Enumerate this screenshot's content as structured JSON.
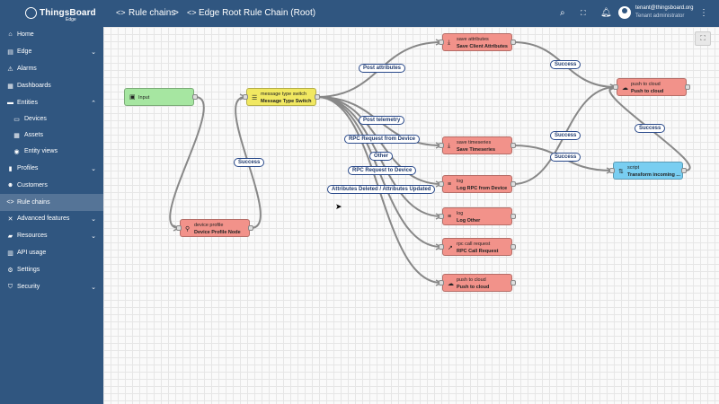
{
  "app": {
    "logo_text": "ThingsBoard",
    "logo_sub": "Edge"
  },
  "sidebar": {
    "items": [
      {
        "icon": "home-icon",
        "glyph": "⌂",
        "label": "Home",
        "chevron": ""
      },
      {
        "icon": "edge-icon",
        "glyph": "▤",
        "label": "Edge",
        "chevron": "⌄"
      },
      {
        "icon": "alarm-icon",
        "glyph": "⚠",
        "label": "Alarms",
        "chevron": ""
      },
      {
        "icon": "dashboard-icon",
        "glyph": "▦",
        "label": "Dashboards",
        "chevron": ""
      },
      {
        "icon": "entities-icon",
        "glyph": "▬",
        "label": "Entities",
        "chevron": "⌃"
      },
      {
        "icon": "devices-icon",
        "glyph": "▭",
        "label": "Devices",
        "chevron": ""
      },
      {
        "icon": "assets-icon",
        "glyph": "▦",
        "label": "Assets",
        "chevron": ""
      },
      {
        "icon": "entity-views-icon",
        "glyph": "◉",
        "label": "Entity views",
        "chevron": ""
      },
      {
        "icon": "profiles-icon",
        "glyph": "▮",
        "label": "Profiles",
        "chevron": "⌄"
      },
      {
        "icon": "customers-icon",
        "glyph": "☻",
        "label": "Customers",
        "chevron": ""
      },
      {
        "icon": "rule-chains-icon",
        "glyph": "<>",
        "label": "Rule chains",
        "chevron": ""
      },
      {
        "icon": "advanced-features-icon",
        "glyph": "✕",
        "label": "Advanced features",
        "chevron": "⌄"
      },
      {
        "icon": "resources-icon",
        "glyph": "▰",
        "label": "Resources",
        "chevron": "⌄"
      },
      {
        "icon": "api-usage-icon",
        "glyph": "▥",
        "label": "API usage",
        "chevron": ""
      },
      {
        "icon": "settings-icon",
        "glyph": "⚙",
        "label": "Settings",
        "chevron": ""
      },
      {
        "icon": "security-icon",
        "glyph": "⛉",
        "label": "Security",
        "chevron": "⌄"
      }
    ]
  },
  "header": {
    "breadcrumb_1": "Rule chains",
    "separator": ">",
    "breadcrumb_2": "Edge Root Rule Chain (Root)",
    "user_email": "tenant@thingsboard.org",
    "user_role": "Tenant administrator"
  },
  "nodes": {
    "input": {
      "name": "Input"
    },
    "switch": {
      "type": "message type switch",
      "name": "Message Type Switch"
    },
    "save_attr": {
      "type": "save attributes",
      "name": "Save Client Attributes"
    },
    "push_cloud_1": {
      "type": "push to cloud",
      "name": "Push to cloud"
    },
    "save_ts": {
      "type": "save timeseries",
      "name": "Save Timeseries"
    },
    "script": {
      "type": "script",
      "name": "Transform incoming ..."
    },
    "log_rpc": {
      "type": "log",
      "name": "Log RPC from Device"
    },
    "log_other": {
      "type": "log",
      "name": "Log Other"
    },
    "rpc_call": {
      "type": "rpc call request",
      "name": "RPC Call Request"
    },
    "push_cloud_2": {
      "type": "push to cloud",
      "name": "Push to cloud"
    },
    "device_profile": {
      "type": "device profile",
      "name": "Device Profile Node"
    }
  },
  "links": {
    "post_attributes": "Post attributes",
    "post_telemetry": "Post telemetry",
    "rpc_from_device": "RPC Request from Device",
    "other": "Other",
    "rpc_to_device": "RPC Request to Device",
    "attr_deleted_updated": "Attributes Deleted / Attributes Updated",
    "success_device_profile": "Success",
    "success_attr": "Success",
    "success_ts": "Success",
    "success_script": "Success",
    "success_log": "Success"
  },
  "colors": {
    "nav_bg": "#305680",
    "input_node": "#a6e6a1",
    "filter_node": "#f1e861",
    "action_node": "#f2928a",
    "transform_node": "#79cef1"
  }
}
